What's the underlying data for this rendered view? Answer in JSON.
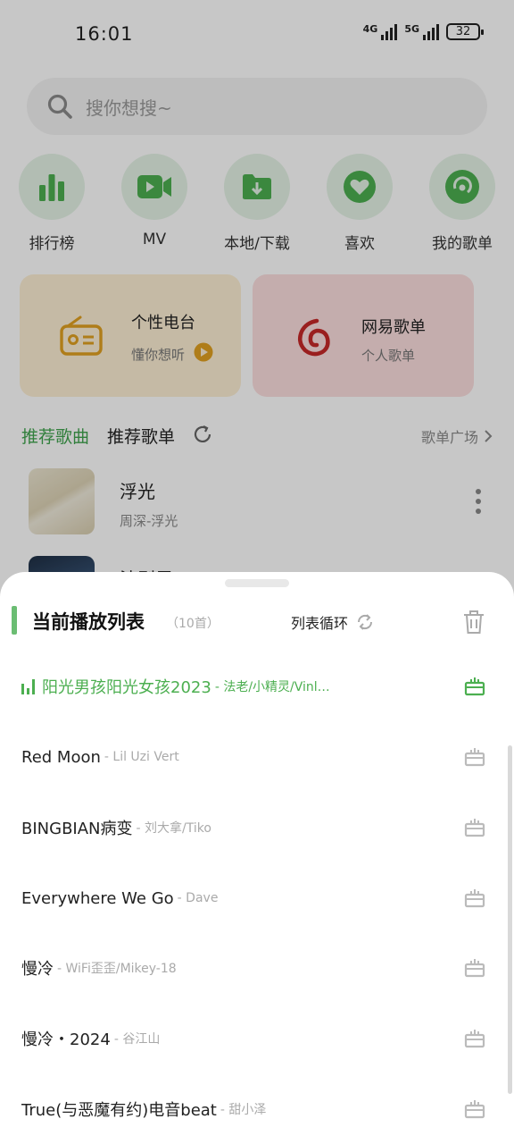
{
  "status_bar": {
    "time": "16:01",
    "net1": "4G",
    "net2": "5G",
    "battery": "32"
  },
  "search": {
    "placeholder": "搜你想搜~"
  },
  "quick_nav": [
    {
      "label": "排行榜",
      "icon": "bar-chart-icon"
    },
    {
      "label": "MV",
      "icon": "video-camera-icon"
    },
    {
      "label": "本地/下载",
      "icon": "folder-download-icon"
    },
    {
      "label": "喜欢",
      "icon": "heart-icon"
    },
    {
      "label": "我的歌单",
      "icon": "disc-icon"
    }
  ],
  "cards": {
    "radio": {
      "title": "个性电台",
      "subtitle": "懂你想听"
    },
    "netease": {
      "title": "网易歌单",
      "subtitle": "个人歌单"
    }
  },
  "tabs": {
    "songs": "推荐歌曲",
    "playlists": "推荐歌单",
    "square": "歌单广场"
  },
  "recommend_songs": [
    {
      "title": "浮光",
      "subtitle": "周深-浮光"
    },
    {
      "title": "法则里",
      "subtitle": ""
    }
  ],
  "sheet": {
    "title": "当前播放列表",
    "count": "（10首）",
    "loop_mode": "列表循环"
  },
  "queue": [
    {
      "title": "阳光男孩阳光女孩2023",
      "artist": "- 法老/小精灵/Vinl…",
      "playing": true
    },
    {
      "title": "Red Moon",
      "artist": "- Lil Uzi Vert",
      "playing": false
    },
    {
      "title": "BINGBIAN病变",
      "artist": "- 刘大拿/Tiko",
      "playing": false
    },
    {
      "title": "Everywhere We Go",
      "artist": "- Dave",
      "playing": false
    },
    {
      "title": "慢冷",
      "artist": "- WiFi歪歪/Mikey-18",
      "playing": false
    },
    {
      "title": "慢冷・2024",
      "artist": "- 谷江山",
      "playing": false
    },
    {
      "title": "True(与恶魔有约)电音beat",
      "artist": "- 甜小泽",
      "playing": false
    }
  ],
  "colors": {
    "accent": "#4caf50",
    "accent_light": "#e4f3e6",
    "netease_red": "#c62828",
    "radio_orange": "#e0a020"
  }
}
